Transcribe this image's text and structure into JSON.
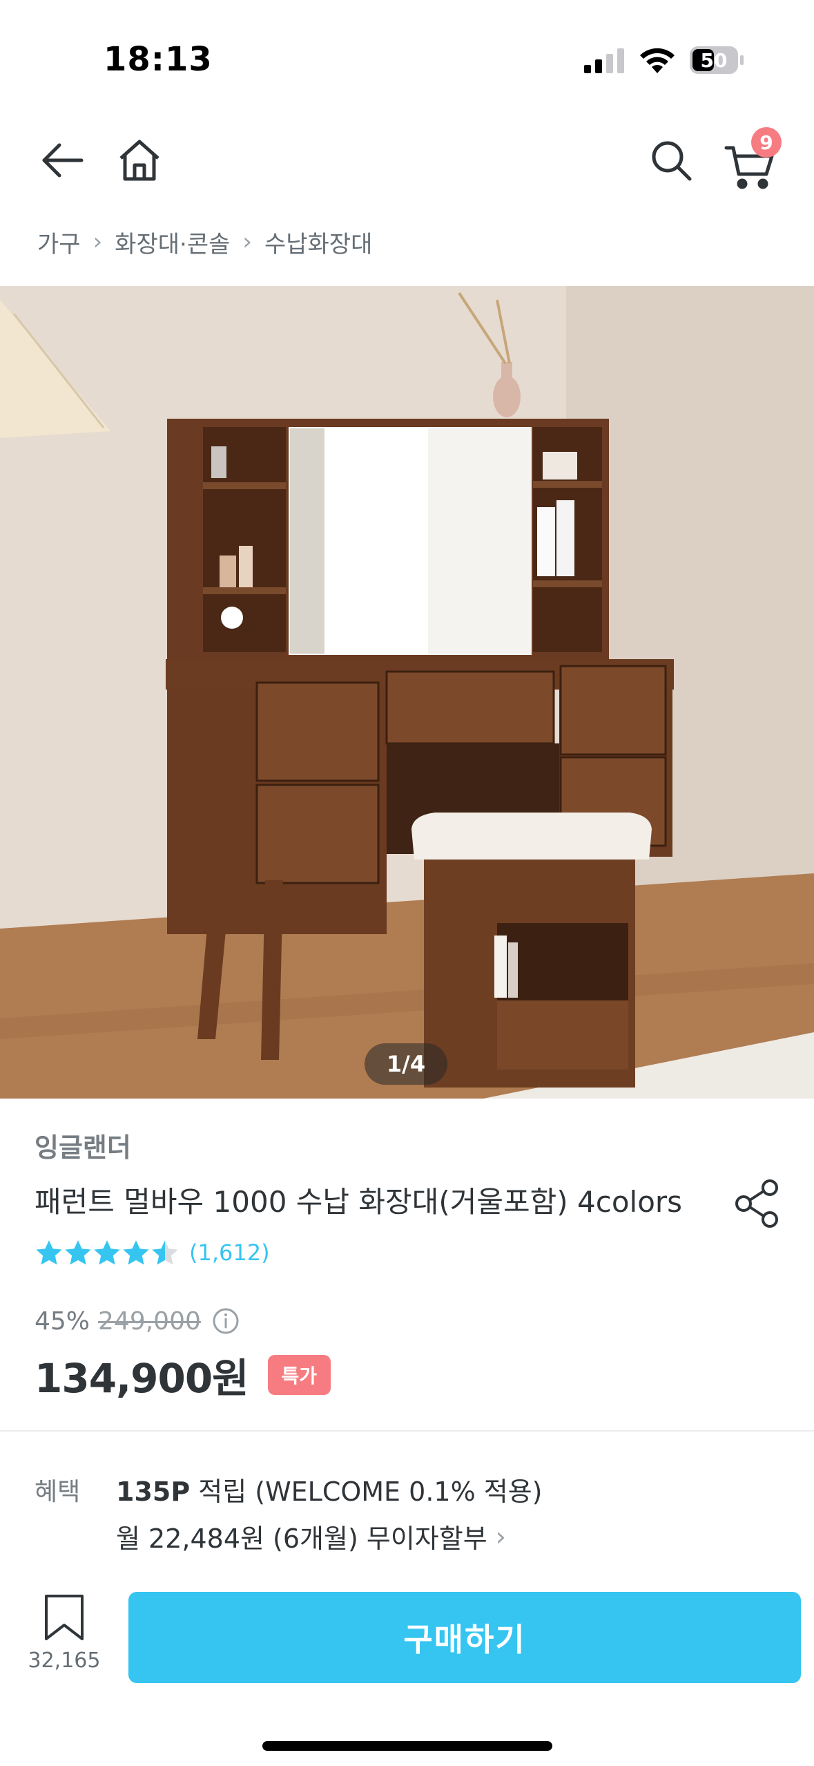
{
  "status_bar": {
    "time": "18:13",
    "battery": "50",
    "icons": [
      "cellular-signal-icon",
      "wifi-icon",
      "battery-icon"
    ]
  },
  "header": {
    "icons": [
      "arrow-left-icon",
      "home-icon",
      "search-icon",
      "cart-icon"
    ],
    "cart_count": "9"
  },
  "breadcrumb": [
    "가구",
    "화장대·콘솔",
    "수납화장대"
  ],
  "gallery": {
    "pager": "1/4"
  },
  "product": {
    "brand": "잉글랜더",
    "title": "패런트 멀바우 1000 수납 화장대(거울포함) 4colors",
    "rating": 4.5,
    "review_count": "(1,612)",
    "discount_rate": "45%",
    "original_price": "249,000",
    "price": "134,900원",
    "badge": "특가"
  },
  "benefits": {
    "label": "혜택",
    "points": "135P",
    "points_text": " 적립 (WELCOME 0.1% 적용)",
    "installment": "월 22,484원 (6개월) 무이자할부"
  },
  "bottom_bar": {
    "bookmark_count": "32,165",
    "buy_label": "구매하기"
  },
  "colors": {
    "accent": "#35c5f0",
    "badge": "#f77c82",
    "text": "#2f3438",
    "muted": "#757c82"
  }
}
